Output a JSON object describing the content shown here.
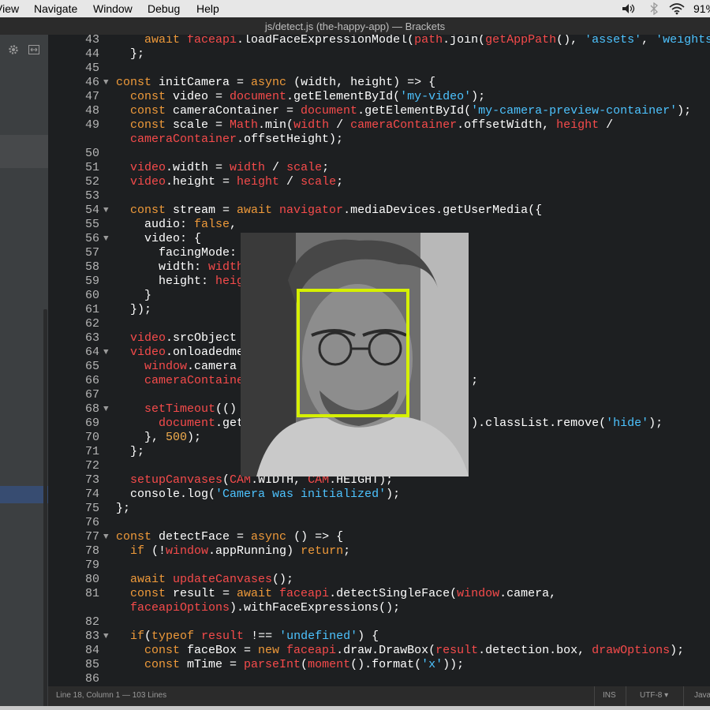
{
  "menubar": {
    "items": [
      "View",
      "Navigate",
      "Window",
      "Debug",
      "Help"
    ],
    "battery": "91%"
  },
  "window": {
    "title": "js/detect.js (the-happy-app) — Brackets"
  },
  "status": {
    "position": "Line 18, Column 1",
    "lines": "— 103 Lines",
    "mode": "INS",
    "encoding": "UTF-8",
    "language": "Java"
  },
  "code": [
    {
      "n": "43",
      "fold": false,
      "t": [
        [
          "    await ",
          "k"
        ],
        [
          "faceapi",
          "r"
        ],
        [
          ".loadFaceExpressionModel(",
          ""
        ],
        [
          "path",
          "r"
        ],
        [
          ".join(",
          ""
        ],
        [
          "getAppPath",
          "r"
        ],
        [
          "(), ",
          ""
        ],
        [
          "'assets'",
          "s"
        ],
        [
          ", ",
          ""
        ],
        [
          "'weights'",
          "s"
        ],
        [
          ")",
          ""
        ]
      ]
    },
    {
      "n": "44",
      "fold": false,
      "t": [
        [
          "  };",
          ""
        ]
      ]
    },
    {
      "n": "45",
      "fold": false,
      "t": []
    },
    {
      "n": "46",
      "fold": true,
      "t": [
        [
          "const ",
          "k"
        ],
        [
          "initCamera = ",
          ""
        ],
        [
          "async ",
          "k"
        ],
        [
          "(width, height) => {",
          ""
        ]
      ]
    },
    {
      "n": "47",
      "fold": false,
      "t": [
        [
          "  const ",
          "k"
        ],
        [
          "video = ",
          ""
        ],
        [
          "document",
          "r"
        ],
        [
          ".getElementById(",
          ""
        ],
        [
          "'my-video'",
          "s"
        ],
        [
          ");",
          ""
        ]
      ]
    },
    {
      "n": "48",
      "fold": false,
      "t": [
        [
          "  const ",
          "k"
        ],
        [
          "cameraContainer = ",
          ""
        ],
        [
          "document",
          "r"
        ],
        [
          ".getElementById(",
          ""
        ],
        [
          "'my-camera-preview-container'",
          "s"
        ],
        [
          ");",
          ""
        ]
      ]
    },
    {
      "n": "49",
      "fold": false,
      "t": [
        [
          "  const ",
          "k"
        ],
        [
          "scale = ",
          ""
        ],
        [
          "Math",
          "r"
        ],
        [
          ".min(",
          ""
        ],
        [
          "width",
          "r"
        ],
        [
          " / ",
          ""
        ],
        [
          "cameraContainer",
          "r"
        ],
        [
          ".offsetWidth, ",
          ""
        ],
        [
          "height",
          "r"
        ],
        [
          " /",
          ""
        ]
      ]
    },
    {
      "n": "",
      "fold": false,
      "t": [
        [
          "  cameraContainer",
          "r"
        ],
        [
          ".offsetHeight);",
          ""
        ]
      ]
    },
    {
      "n": "50",
      "fold": false,
      "t": []
    },
    {
      "n": "51",
      "fold": false,
      "t": [
        [
          "  video",
          "r"
        ],
        [
          ".width = ",
          ""
        ],
        [
          "width",
          "r"
        ],
        [
          " / ",
          ""
        ],
        [
          "scale",
          "r"
        ],
        [
          ";",
          ""
        ]
      ]
    },
    {
      "n": "52",
      "fold": false,
      "t": [
        [
          "  video",
          "r"
        ],
        [
          ".height = ",
          ""
        ],
        [
          "height",
          "r"
        ],
        [
          " / ",
          ""
        ],
        [
          "scale",
          "r"
        ],
        [
          ";",
          ""
        ]
      ]
    },
    {
      "n": "53",
      "fold": false,
      "t": []
    },
    {
      "n": "54",
      "fold": true,
      "t": [
        [
          "  const ",
          "k"
        ],
        [
          "stream = ",
          ""
        ],
        [
          "await ",
          "k"
        ],
        [
          "navigator",
          "r"
        ],
        [
          ".mediaDevices.getUserMedia({",
          ""
        ]
      ]
    },
    {
      "n": "55",
      "fold": false,
      "t": [
        [
          "    audio: ",
          ""
        ],
        [
          "false",
          "k"
        ],
        [
          ",",
          ""
        ]
      ]
    },
    {
      "n": "56",
      "fold": true,
      "t": [
        [
          "    video: {",
          ""
        ]
      ]
    },
    {
      "n": "57",
      "fold": false,
      "t": [
        [
          "      facingMode:",
          ""
        ]
      ]
    },
    {
      "n": "58",
      "fold": false,
      "t": [
        [
          "      width: ",
          ""
        ],
        [
          "width",
          "r"
        ]
      ]
    },
    {
      "n": "59",
      "fold": false,
      "t": [
        [
          "      height: ",
          ""
        ],
        [
          "heig",
          "r"
        ]
      ]
    },
    {
      "n": "60",
      "fold": false,
      "t": [
        [
          "    }",
          ""
        ]
      ]
    },
    {
      "n": "61",
      "fold": false,
      "t": [
        [
          "  });",
          ""
        ]
      ]
    },
    {
      "n": "62",
      "fold": false,
      "t": []
    },
    {
      "n": "63",
      "fold": false,
      "t": [
        [
          "  video",
          "r"
        ],
        [
          ".srcObject",
          ""
        ]
      ]
    },
    {
      "n": "64",
      "fold": true,
      "t": [
        [
          "  video",
          "r"
        ],
        [
          ".onloadedme",
          ""
        ]
      ]
    },
    {
      "n": "65",
      "fold": false,
      "t": [
        [
          "    window",
          "r"
        ],
        [
          ".camera",
          ""
        ]
      ]
    },
    {
      "n": "66",
      "fold": false,
      "t": [
        [
          "    cameraContaine",
          "r"
        ],
        [
          "                                ;",
          ""
        ]
      ]
    },
    {
      "n": "67",
      "fold": false,
      "t": []
    },
    {
      "n": "68",
      "fold": true,
      "t": [
        [
          "    setTimeout",
          "r"
        ],
        [
          "(()",
          ""
        ]
      ]
    },
    {
      "n": "69",
      "fold": false,
      "t": [
        [
          "      document",
          "r"
        ],
        [
          ".get",
          ""
        ],
        [
          "                            ton'",
          "s"
        ],
        [
          ").classList.remove(",
          ""
        ],
        [
          "'hide'",
          "s"
        ],
        [
          ");",
          ""
        ]
      ]
    },
    {
      "n": "70",
      "fold": false,
      "t": [
        [
          "    }, ",
          ""
        ],
        [
          "500",
          "n"
        ],
        [
          ");",
          ""
        ]
      ]
    },
    {
      "n": "71",
      "fold": false,
      "t": [
        [
          "  };",
          ""
        ]
      ]
    },
    {
      "n": "72",
      "fold": false,
      "t": []
    },
    {
      "n": "73",
      "fold": false,
      "t": [
        [
          "  setupCanvases",
          "r"
        ],
        [
          "(",
          ""
        ],
        [
          "CAM",
          "r"
        ],
        [
          ".WIDTH, ",
          ""
        ],
        [
          "CAM",
          "r"
        ],
        [
          ".HEIGHT);",
          ""
        ]
      ]
    },
    {
      "n": "74",
      "fold": false,
      "t": [
        [
          "  console",
          ""
        ],
        [
          ".log(",
          ""
        ],
        [
          "'Camera was initialized'",
          "s"
        ],
        [
          ");",
          ""
        ]
      ]
    },
    {
      "n": "75",
      "fold": false,
      "t": [
        [
          "};",
          ""
        ]
      ]
    },
    {
      "n": "76",
      "fold": false,
      "t": []
    },
    {
      "n": "77",
      "fold": true,
      "t": [
        [
          "const ",
          "k"
        ],
        [
          "detectFace = ",
          ""
        ],
        [
          "async ",
          "k"
        ],
        [
          "() => {",
          ""
        ]
      ]
    },
    {
      "n": "78",
      "fold": false,
      "t": [
        [
          "  if ",
          "k"
        ],
        [
          "(!",
          ""
        ],
        [
          "window",
          "r"
        ],
        [
          ".appRunning) ",
          ""
        ],
        [
          "return",
          "k"
        ],
        [
          ";",
          ""
        ]
      ]
    },
    {
      "n": "79",
      "fold": false,
      "t": []
    },
    {
      "n": "80",
      "fold": false,
      "t": [
        [
          "  await ",
          "k"
        ],
        [
          "updateCanvases",
          "r"
        ],
        [
          "();",
          ""
        ]
      ]
    },
    {
      "n": "81",
      "fold": false,
      "t": [
        [
          "  const ",
          "k"
        ],
        [
          "result = ",
          ""
        ],
        [
          "await ",
          "k"
        ],
        [
          "faceapi",
          "r"
        ],
        [
          ".detectSingleFace(",
          ""
        ],
        [
          "window",
          "r"
        ],
        [
          ".camera,",
          ""
        ]
      ]
    },
    {
      "n": "",
      "fold": false,
      "t": [
        [
          "  faceapiOptions",
          "r"
        ],
        [
          ").withFaceExpressions();",
          ""
        ]
      ]
    },
    {
      "n": "82",
      "fold": false,
      "t": []
    },
    {
      "n": "83",
      "fold": true,
      "t": [
        [
          "  if",
          "k"
        ],
        [
          "(",
          ""
        ],
        [
          "typeof ",
          "k"
        ],
        [
          "result",
          "r"
        ],
        [
          " !== ",
          ""
        ],
        [
          "'undefined'",
          "s"
        ],
        [
          ") {",
          ""
        ]
      ]
    },
    {
      "n": "84",
      "fold": false,
      "t": [
        [
          "    const ",
          "k"
        ],
        [
          "faceBox = ",
          ""
        ],
        [
          "new ",
          "k"
        ],
        [
          "faceapi",
          "r"
        ],
        [
          ".draw.DrawBox(",
          ""
        ],
        [
          "result",
          "r"
        ],
        [
          ".detection.box, ",
          ""
        ],
        [
          "drawOptions",
          "r"
        ],
        [
          ");",
          ""
        ]
      ]
    },
    {
      "n": "85",
      "fold": false,
      "t": [
        [
          "    const ",
          "k"
        ],
        [
          "mTime = ",
          ""
        ],
        [
          "parseInt",
          "r"
        ],
        [
          "(",
          ""
        ],
        [
          "moment",
          "r"
        ],
        [
          "().format(",
          ""
        ],
        [
          "'x'",
          "s"
        ],
        [
          "));",
          ""
        ]
      ]
    },
    {
      "n": "86",
      "fold": false,
      "t": []
    }
  ]
}
